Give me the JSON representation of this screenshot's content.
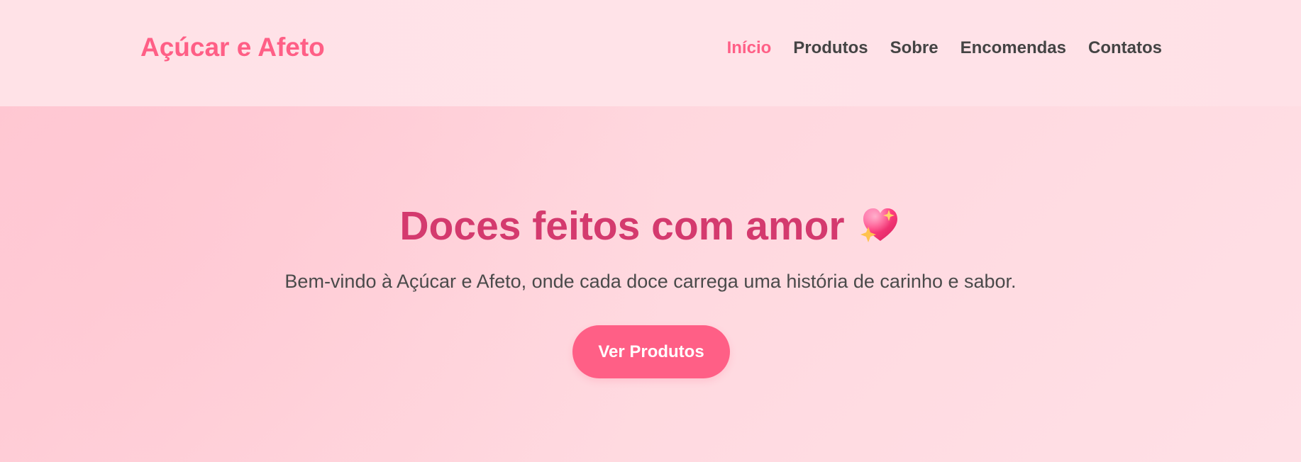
{
  "header": {
    "brand": "Açúcar e Afeto",
    "nav": [
      {
        "label": "Início",
        "active": true
      },
      {
        "label": "Produtos",
        "active": false
      },
      {
        "label": "Sobre",
        "active": false
      },
      {
        "label": "Encomendas",
        "active": false
      },
      {
        "label": "Contatos",
        "active": false
      }
    ]
  },
  "hero": {
    "title": "Doces feitos com amor",
    "title_icon": "sparkling-heart-icon",
    "subtitle": "Bem-vindo à Açúcar e Afeto, onde cada doce carrega uma história de carinho e sabor.",
    "cta_label": "Ver Produtos"
  },
  "colors": {
    "brand": "#ff5f86",
    "title": "#d43a6e",
    "nav_text": "#444444",
    "header_bg": "#ffe2e7",
    "hero_bg": "#ffd7de",
    "button_bg": "#ff5f86",
    "button_text": "#ffffff"
  }
}
